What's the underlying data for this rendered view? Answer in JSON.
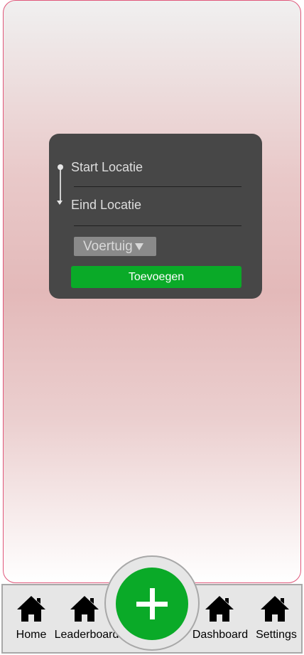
{
  "route_form": {
    "start_placeholder": "Start Locatie",
    "end_placeholder": "Eind Locatie",
    "vehicle_select": "Voertuig",
    "add_button": "Toevoegen"
  },
  "nav": {
    "items": [
      {
        "label": "Home",
        "icon": "home-icon"
      },
      {
        "label": "Leaderboard",
        "icon": "home-icon"
      },
      {
        "label": "Dashboard",
        "icon": "home-icon"
      },
      {
        "label": "Settings",
        "icon": "home-icon"
      }
    ],
    "fab_icon": "plus-icon"
  },
  "colors": {
    "accent_green": "#0aaa28",
    "card_bg": "#474747",
    "screen_border": "#e0577a"
  }
}
